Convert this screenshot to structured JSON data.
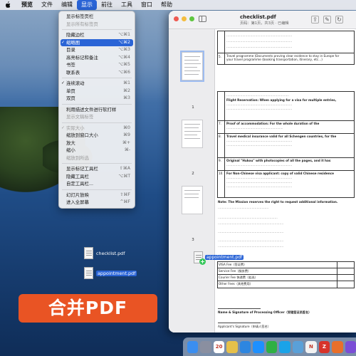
{
  "menubar": {
    "items": [
      "预览",
      "文件",
      "编辑",
      "显示",
      "前往",
      "工具",
      "窗口",
      "帮助"
    ],
    "active_index": 3
  },
  "view_menu": {
    "items": [
      {
        "label": "显示标签页栏",
        "shortcut": "",
        "checked": false,
        "disabled": false
      },
      {
        "label": "显示所有标签页",
        "shortcut": "",
        "checked": false,
        "disabled": true
      },
      {
        "sep": true
      },
      {
        "label": "隐藏边栏",
        "shortcut": "⌥⌘1",
        "checked": false,
        "disabled": false
      },
      {
        "label": "缩略图",
        "shortcut": "⌥⌘2",
        "checked": true,
        "disabled": false,
        "highlight": true
      },
      {
        "label": "目录",
        "shortcut": "⌥⌘3",
        "checked": false,
        "disabled": false
      },
      {
        "label": "高亮标记和备注",
        "shortcut": "⌥⌘4",
        "checked": false,
        "disabled": false
      },
      {
        "label": "书签",
        "shortcut": "⌥⌘5",
        "checked": false,
        "disabled": false
      },
      {
        "label": "联系表",
        "shortcut": "⌥⌘6",
        "checked": false,
        "disabled": false
      },
      {
        "sep": true
      },
      {
        "label": "连续滚动",
        "shortcut": "⌘1",
        "checked": true,
        "disabled": false
      },
      {
        "label": "单页",
        "shortcut": "⌘2",
        "checked": false,
        "disabled": false
      },
      {
        "label": "双页",
        "shortcut": "⌘3",
        "checked": false,
        "disabled": false
      },
      {
        "sep": true
      },
      {
        "label": "利用描述文件进行软打样",
        "shortcut": "",
        "checked": false,
        "disabled": false
      },
      {
        "label": "显示文稿标签",
        "shortcut": "",
        "checked": false,
        "disabled": true
      },
      {
        "sep": true
      },
      {
        "label": "实际大小",
        "shortcut": "⌘0",
        "checked": true,
        "disabled": true
      },
      {
        "label": "缩放到窗口大小",
        "shortcut": "⌘9",
        "checked": false,
        "disabled": false
      },
      {
        "label": "放大",
        "shortcut": "⌘+",
        "checked": false,
        "disabled": false
      },
      {
        "label": "缩小",
        "shortcut": "⌘-",
        "checked": false,
        "disabled": false
      },
      {
        "label": "缩放到所选",
        "shortcut": "",
        "checked": false,
        "disabled": true
      },
      {
        "sep": true
      },
      {
        "label": "显示标记工具栏",
        "shortcut": "⇧⌘A",
        "checked": false,
        "disabled": false
      },
      {
        "label": "隐藏工具栏",
        "shortcut": "⌥⌘T",
        "checked": false,
        "disabled": false
      },
      {
        "label": "自定工具栏...",
        "shortcut": "",
        "checked": false,
        "disabled": false
      },
      {
        "sep": true
      },
      {
        "label": "幻灯片放映",
        "shortcut": "⇧⌘F",
        "checked": false,
        "disabled": false
      },
      {
        "label": "进入全屏幕",
        "shortcut": "^⌘F",
        "checked": false,
        "disabled": false
      }
    ]
  },
  "preview_window": {
    "title": "checklist.pdf",
    "subtitle": "页码：第1页，共3页 · 已编辑",
    "thumbnails": [
      {
        "label": "1"
      },
      {
        "label": "2"
      },
      {
        "label": "3"
      }
    ]
  },
  "document": {
    "row5_num": "5.",
    "row5_text": "Travel programme (Documents proving clear evidence to stay in Europe for",
    "row5_text2": "your travel programme (booking transportation, itinerary, etc...)",
    "row1_text": "Flight Reservation: When applying for a visa for multiple entries,",
    "row7_text": "Proof of accommodation: For the whole duration of the",
    "row8_text": "Travel medical insurance valid for all Schengen countries, for the",
    "row9_text": "Original \"Hukou\" with photocopies of all the pages, and it has",
    "row10_text": "For Non-Chinese visa applicant: copy of valid Chinese residence",
    "note_text": "Note: The Mission reserves the right to request additional information.",
    "visa_fee": "VISA Fee（签证费）",
    "service_fee": "Service Fee（服务费）",
    "courier_fee": "Courier Fee 快递费（若选）",
    "other_fees": "Other Fees（其他费用）",
    "signature_officer": "Name & Signature of Processing Officer（受理签证员签名）",
    "signature_applicant": "Applicant's Signature（申请人签名）"
  },
  "desktop_files": [
    {
      "name": "checklist.pdf",
      "selected": false
    },
    {
      "name": "appointment.pdf",
      "selected": true
    }
  ],
  "drag_file": {
    "name": "appointment.pdf"
  },
  "overlay_title": "合并PDF",
  "dock": {
    "icons": [
      {
        "name": "finder-icon",
        "color": "#3a8ef0",
        "text": ""
      },
      {
        "name": "launchpad-icon",
        "color": "#8a8fa0",
        "text": ""
      },
      {
        "name": "calendar-icon",
        "color": "#ffffff",
        "text": "20"
      },
      {
        "name": "photos-icon",
        "color": "#e6c04a",
        "text": ""
      },
      {
        "name": "finder2-icon",
        "color": "#2d86e0",
        "text": ""
      },
      {
        "name": "safari-icon",
        "color": "#1e90ff",
        "text": ""
      },
      {
        "name": "wechat-icon",
        "color": "#2fb043",
        "text": ""
      },
      {
        "name": "qq-icon",
        "color": "#1aa3e8",
        "text": ""
      },
      {
        "name": "preview-icon",
        "color": "#5aa0d8",
        "text": ""
      },
      {
        "name": "notion-icon",
        "color": "#f2f2f2",
        "text": "N"
      },
      {
        "name": "app-red-icon",
        "color": "#d8332a",
        "text": "Z"
      },
      {
        "name": "app-orange-icon",
        "color": "#e86f2a",
        "text": ""
      },
      {
        "name": "app-purple-icon",
        "color": "#7b4ed6",
        "text": ""
      }
    ]
  }
}
